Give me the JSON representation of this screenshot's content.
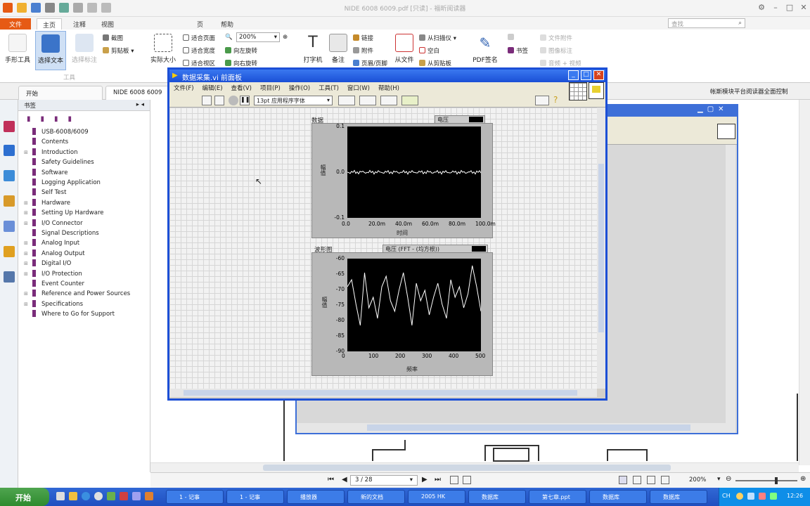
{
  "app": {
    "title": "NIDE 6008 6009.pdf [只读] - 福昕阅读器"
  },
  "ribbon_tabs": [
    "文件",
    "主页",
    "注释",
    "视图",
    "页",
    "帮助"
  ],
  "ribbon": {
    "hand_tool": "手形工具",
    "select_text": "选择文本",
    "select_note": "选择标注",
    "tools_group": "工具",
    "screenshot": "截图",
    "clipboard": "剪贴板",
    "actual_size": "实际大小",
    "fit_page": "适合页面",
    "fit_width": "适合宽度",
    "fit_visible": "适合视区",
    "zoom_value": "200%",
    "rotate_left": "向左旋转",
    "rotate_right": "向右旋转",
    "typewriter": "打字机",
    "note": "备注",
    "link": "链接",
    "attachment": "附件",
    "header": "页眉/页脚",
    "from_file": "从文件",
    "from_scanner": "从扫描仪",
    "blank": "空白",
    "from_clipboard": "从剪贴板",
    "sign": "PDF签名",
    "bookmark": "书签",
    "file_attach": "文件附件",
    "image_note": "图像标注",
    "audio_video": "音频 + 视频"
  },
  "search_placeholder": "查找",
  "doc_tabs": [
    "开始",
    "NIDE 6008 6009"
  ],
  "doc_tab_right": "帐斯模块平台阅读器全面控制",
  "bookmarks": {
    "header": "书签",
    "items": [
      {
        "label": "USB-6008/6009",
        "exp": ""
      },
      {
        "label": "Contents",
        "exp": ""
      },
      {
        "label": "Introduction",
        "exp": "+"
      },
      {
        "label": "Safety Guidelines",
        "exp": ""
      },
      {
        "label": "Software",
        "exp": ""
      },
      {
        "label": "Logging Application",
        "exp": ""
      },
      {
        "label": "Self Test",
        "exp": ""
      },
      {
        "label": "Hardware",
        "exp": "+"
      },
      {
        "label": "Setting Up Hardware",
        "exp": "+"
      },
      {
        "label": "I/O Connector",
        "exp": "+"
      },
      {
        "label": "Signal Descriptions",
        "exp": ""
      },
      {
        "label": "Analog Input",
        "exp": "+"
      },
      {
        "label": "Analog Output",
        "exp": "+"
      },
      {
        "label": "Digital I/O",
        "exp": "+"
      },
      {
        "label": "I/O Protection",
        "exp": "+"
      },
      {
        "label": "Event Counter",
        "exp": ""
      },
      {
        "label": "Reference and Power Sources",
        "exp": "+"
      },
      {
        "label": "Specifications",
        "exp": "+"
      },
      {
        "label": "Where to Go for Support",
        "exp": ""
      }
    ]
  },
  "labview": {
    "title": "数据采集.vi 前面板",
    "menu": [
      "文件(F)",
      "编辑(E)",
      "查看(V)",
      "项目(P)",
      "操作(O)",
      "工具(T)",
      "窗口(W)",
      "帮助(H)"
    ],
    "font_select": "13pt 应用程序字体",
    "graph1": {
      "name": "数据",
      "legend": "电压",
      "ylabel": "幅值",
      "xlabel": "时间",
      "yticks": [
        "0.1",
        "0.0",
        "-0.1"
      ],
      "xticks": [
        "0.0",
        "20.0m",
        "40.0m",
        "60.0m",
        "80.0m",
        "100.0m"
      ]
    },
    "graph2": {
      "name": "波形图",
      "legend": "电压 (FFT - (均方根))",
      "ylabel": "幅值",
      "xlabel": "频率",
      "yticks": [
        "-60",
        "-65",
        "-70",
        "-75",
        "-80",
        "-85",
        "-90"
      ],
      "xticks": [
        "0",
        "100",
        "200",
        "300",
        "400",
        "500"
      ]
    }
  },
  "status": {
    "page": "3 / 28",
    "zoom": "200%"
  },
  "taskbar": {
    "start": "开始",
    "items": [
      "1 - 记事",
      "1 - 记事",
      "播放器",
      "新的文档",
      "2005 HK",
      "数据库",
      "第七章.ppt",
      "数据库",
      "数据库"
    ],
    "tray": [
      "CH",
      "12:26"
    ]
  }
}
